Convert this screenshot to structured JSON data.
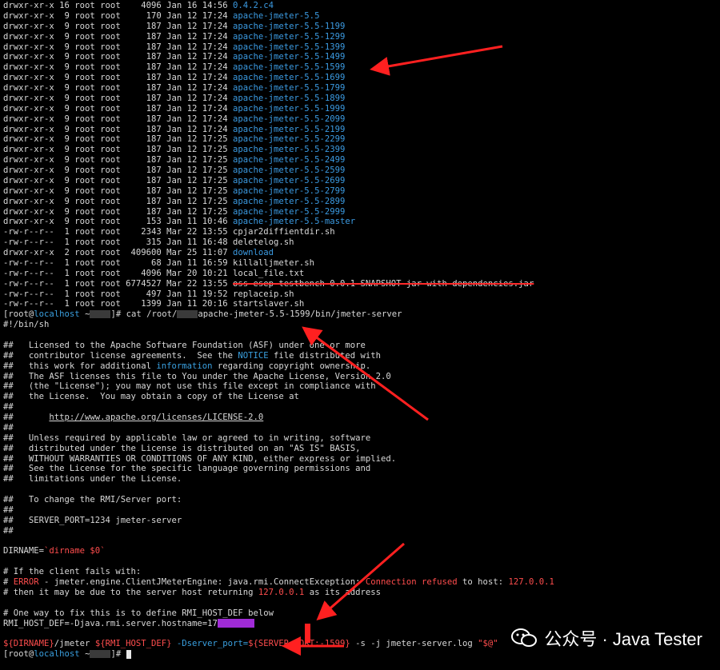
{
  "terminal": {
    "listing": [
      {
        "perm": "drwxr-xr-x",
        "links": "16",
        "owner": "root",
        "group": "root",
        "size": "4096",
        "month": "Jan",
        "day": "16",
        "time": "14:56",
        "name": "0.4.2.c4",
        "kind": "dir"
      },
      {
        "perm": "drwxr-xr-x",
        "links": "9",
        "owner": "root",
        "group": "root",
        "size": "170",
        "month": "Jan",
        "day": "12",
        "time": "17:24",
        "name": "apache-jmeter-5.5",
        "kind": "dir"
      },
      {
        "perm": "drwxr-xr-x",
        "links": "9",
        "owner": "root",
        "group": "root",
        "size": "187",
        "month": "Jan",
        "day": "12",
        "time": "17:24",
        "name": "apache-jmeter-5.5-1199",
        "kind": "dir"
      },
      {
        "perm": "drwxr-xr-x",
        "links": "9",
        "owner": "root",
        "group": "root",
        "size": "187",
        "month": "Jan",
        "day": "12",
        "time": "17:24",
        "name": "apache-jmeter-5.5-1299",
        "kind": "dir"
      },
      {
        "perm": "drwxr-xr-x",
        "links": "9",
        "owner": "root",
        "group": "root",
        "size": "187",
        "month": "Jan",
        "day": "12",
        "time": "17:24",
        "name": "apache-jmeter-5.5-1399",
        "kind": "dir"
      },
      {
        "perm": "drwxr-xr-x",
        "links": "9",
        "owner": "root",
        "group": "root",
        "size": "187",
        "month": "Jan",
        "day": "12",
        "time": "17:24",
        "name": "apache-jmeter-5.5-1499",
        "kind": "dir"
      },
      {
        "perm": "drwxr-xr-x",
        "links": "9",
        "owner": "root",
        "group": "root",
        "size": "187",
        "month": "Jan",
        "day": "12",
        "time": "17:24",
        "name": "apache-jmeter-5.5-1599",
        "kind": "dir"
      },
      {
        "perm": "drwxr-xr-x",
        "links": "9",
        "owner": "root",
        "group": "root",
        "size": "187",
        "month": "Jan",
        "day": "12",
        "time": "17:24",
        "name": "apache-jmeter-5.5-1699",
        "kind": "dir"
      },
      {
        "perm": "drwxr-xr-x",
        "links": "9",
        "owner": "root",
        "group": "root",
        "size": "187",
        "month": "Jan",
        "day": "12",
        "time": "17:24",
        "name": "apache-jmeter-5.5-1799",
        "kind": "dir"
      },
      {
        "perm": "drwxr-xr-x",
        "links": "9",
        "owner": "root",
        "group": "root",
        "size": "187",
        "month": "Jan",
        "day": "12",
        "time": "17:24",
        "name": "apache-jmeter-5.5-1899",
        "kind": "dir"
      },
      {
        "perm": "drwxr-xr-x",
        "links": "9",
        "owner": "root",
        "group": "root",
        "size": "187",
        "month": "Jan",
        "day": "12",
        "time": "17:24",
        "name": "apache-jmeter-5.5-1999",
        "kind": "dir"
      },
      {
        "perm": "drwxr-xr-x",
        "links": "9",
        "owner": "root",
        "group": "root",
        "size": "187",
        "month": "Jan",
        "day": "12",
        "time": "17:24",
        "name": "apache-jmeter-5.5-2099",
        "kind": "dir"
      },
      {
        "perm": "drwxr-xr-x",
        "links": "9",
        "owner": "root",
        "group": "root",
        "size": "187",
        "month": "Jan",
        "day": "12",
        "time": "17:24",
        "name": "apache-jmeter-5.5-2199",
        "kind": "dir"
      },
      {
        "perm": "drwxr-xr-x",
        "links": "9",
        "owner": "root",
        "group": "root",
        "size": "187",
        "month": "Jan",
        "day": "12",
        "time": "17:25",
        "name": "apache-jmeter-5.5-2299",
        "kind": "dir"
      },
      {
        "perm": "drwxr-xr-x",
        "links": "9",
        "owner": "root",
        "group": "root",
        "size": "187",
        "month": "Jan",
        "day": "12",
        "time": "17:25",
        "name": "apache-jmeter-5.5-2399",
        "kind": "dir"
      },
      {
        "perm": "drwxr-xr-x",
        "links": "9",
        "owner": "root",
        "group": "root",
        "size": "187",
        "month": "Jan",
        "day": "12",
        "time": "17:25",
        "name": "apache-jmeter-5.5-2499",
        "kind": "dir"
      },
      {
        "perm": "drwxr-xr-x",
        "links": "9",
        "owner": "root",
        "group": "root",
        "size": "187",
        "month": "Jan",
        "day": "12",
        "time": "17:25",
        "name": "apache-jmeter-5.5-2599",
        "kind": "dir"
      },
      {
        "perm": "drwxr-xr-x",
        "links": "9",
        "owner": "root",
        "group": "root",
        "size": "187",
        "month": "Jan",
        "day": "12",
        "time": "17:25",
        "name": "apache-jmeter-5.5-2699",
        "kind": "dir"
      },
      {
        "perm": "drwxr-xr-x",
        "links": "9",
        "owner": "root",
        "group": "root",
        "size": "187",
        "month": "Jan",
        "day": "12",
        "time": "17:25",
        "name": "apache-jmeter-5.5-2799",
        "kind": "dir"
      },
      {
        "perm": "drwxr-xr-x",
        "links": "9",
        "owner": "root",
        "group": "root",
        "size": "187",
        "month": "Jan",
        "day": "12",
        "time": "17:25",
        "name": "apache-jmeter-5.5-2899",
        "kind": "dir"
      },
      {
        "perm": "drwxr-xr-x",
        "links": "9",
        "owner": "root",
        "group": "root",
        "size": "187",
        "month": "Jan",
        "day": "12",
        "time": "17:25",
        "name": "apache-jmeter-5.5-2999",
        "kind": "dir"
      },
      {
        "perm": "drwxr-xr-x",
        "links": "9",
        "owner": "root",
        "group": "root",
        "size": "153",
        "month": "Jan",
        "day": "11",
        "time": "10:46",
        "name": "apache-jmeter-5.5-master",
        "kind": "dir"
      },
      {
        "perm": "-rw-r--r--",
        "links": "1",
        "owner": "root",
        "group": "root",
        "size": "2343",
        "month": "Mar",
        "day": "22",
        "time": "13:55",
        "name": "cpjar2diffientdir.sh",
        "kind": "file"
      },
      {
        "perm": "-rw-r--r--",
        "links": "1",
        "owner": "root",
        "group": "root",
        "size": "315",
        "month": "Jan",
        "day": "11",
        "time": "16:48",
        "name": "deletelog.sh",
        "kind": "file"
      },
      {
        "perm": "drwxr-xr-x",
        "links": "2",
        "owner": "root",
        "group": "root",
        "size": "409600",
        "month": "Mar",
        "day": "25",
        "time": "11:07",
        "name": "download",
        "kind": "dir"
      },
      {
        "perm": "-rw-r--r--",
        "links": "1",
        "owner": "root",
        "group": "root",
        "size": "68",
        "month": "Jan",
        "day": "11",
        "time": "16:59",
        "name": "killalljmeter.sh",
        "kind": "file"
      },
      {
        "perm": "-rw-r--r--",
        "links": "1",
        "owner": "root",
        "group": "root",
        "size": "4096",
        "month": "Mar",
        "day": "20",
        "time": "10:21",
        "name": "local_file.txt",
        "kind": "file"
      },
      {
        "perm": "-rw-r--r--",
        "links": "1",
        "owner": "root",
        "group": "root",
        "size": "6774527",
        "month": "Mar",
        "day": "22",
        "time": "13:55",
        "name": "oss-esep-testbench-0.0.1-SNAPSHOT-jar-with-dependencies.jar",
        "kind": "struck"
      },
      {
        "perm": "-rw-r--r--",
        "links": "1",
        "owner": "root",
        "group": "root",
        "size": "497",
        "month": "Jan",
        "day": "11",
        "time": "19:52",
        "name": "replaceip.sh",
        "kind": "file"
      },
      {
        "perm": "-rw-r--r--",
        "links": "1",
        "owner": "root",
        "group": "root",
        "size": "1399",
        "month": "Jan",
        "day": "11",
        "time": "20:16",
        "name": "startslaver.sh",
        "kind": "file"
      }
    ],
    "prompt": {
      "open": "[root@",
      "host": "localhost",
      "rest": " ~",
      "close": "]# ",
      "command_prefix": "cat /root/",
      "command_suffix": "apache-jmeter-5.5-1599/bin/jmeter-server"
    },
    "shebang": "#!/bin/sh",
    "license": {
      "l1_a": "##   Licensed to the Apache Software Foundation (ASF) under one or more",
      "l2_a": "##   contributor license agreements.  See the ",
      "l2_b": "NOTICE",
      "l2_c": " file distributed with",
      "l3_a": "##   this work for additional ",
      "l3_b": "information",
      "l3_c": " regarding copyright ownership.",
      "l4": "##   The ASF licenses this file to You under the Apache License, Version 2.0",
      "l5": "##   (the \"License\"); you may not use this file except in compliance with",
      "l6": "##   the License.  You may obtain a copy of the License at",
      "hash": "##",
      "url_prefix": "##       ",
      "url": "http://www.apache.org/licenses/LICENSE-2.0",
      "l7": "##   Unless required by applicable law or agreed to in writing, software",
      "l8": "##   distributed under the License is distributed on an \"AS IS\" BASIS,",
      "l9": "##   WITHOUT WARRANTIES OR CONDITIONS OF ANY KIND, either express or implied.",
      "l10": "##   See the License for the specific language governing permissions and",
      "l11": "##   limitations under the License.",
      "l12": "##   To change the RMI/Server port:",
      "l13": "##   SERVER_PORT=1234 jmeter-server"
    },
    "dirname_a": "DIRNAME=",
    "dirname_b": "`dirname $0`",
    "c1": "# If the client fails with:",
    "c2_a": "# ",
    "c2_b": "ERROR",
    "c2_c": " - jmeter.engine.ClientJMeterEngine: java.rmi.ConnectException: ",
    "c2_d": "Connection refused",
    "c2_e": " to host: ",
    "c2_f": "127.0.0.1",
    "c3_a": "# then it may be due to the server host returning ",
    "c3_b": "127.0.0.1",
    "c3_c": " as its address",
    "c4": "# One way to fix this is to define RMI_HOST_DEF below",
    "rmi_a": "RMI_HOST_DEF=-Djava.rmi.server.hostname=",
    "rmi_b": "17",
    "exec_a": "${DIRNAME}",
    "exec_b": "/jmeter ",
    "exec_c": "${RMI_HOST_DEF}",
    "exec_d": " -Dserver_port=",
    "exec_e": "${SERVER_PORT:-1599}",
    "exec_f": " -s -j jmeter-server.log ",
    "exec_g": "\"$@\""
  },
  "watermark": {
    "text": "公众号 · Java Tester"
  },
  "colors": {
    "background": "#000000",
    "text": "#d8d8d8",
    "directory": "#3b9ae1",
    "highlight": "#2ab7d3",
    "error": "#ff4d4d",
    "arrow": "#ff2020"
  }
}
